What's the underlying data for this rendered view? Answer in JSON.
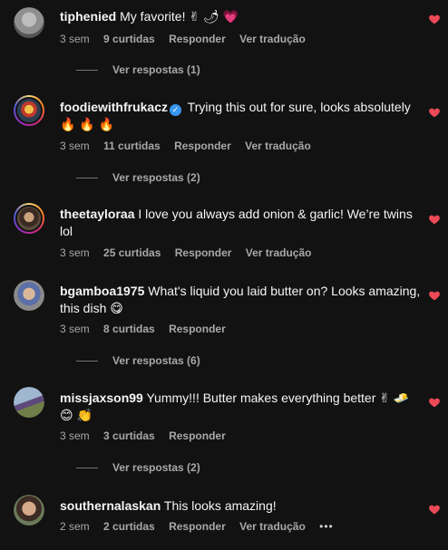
{
  "accent": {
    "heart": "#ed4956",
    "verified": "#3897f0"
  },
  "comments": [
    {
      "username": "tiphenied",
      "verified": false,
      "text": "My favorite! ✌ 🌶 💗",
      "time": "3 sem",
      "likes": "9 curtidas",
      "reply": "Responder",
      "translate": "Ver tradução",
      "view_replies": "Ver respostas (1)"
    },
    {
      "username": "foodiewithfrukacz",
      "verified": true,
      "text": "Trying this out for sure, looks absolutely 🔥 🔥 🔥",
      "time": "3 sem",
      "likes": "11 curtidas",
      "reply": "Responder",
      "translate": "Ver tradução",
      "view_replies": "Ver respostas (2)"
    },
    {
      "username": "theetayloraa",
      "verified": false,
      "text": "I love you always add onion & garlic! We’re twins lol",
      "time": "3 sem",
      "likes": "25 curtidas",
      "reply": "Responder",
      "translate": "Ver tradução",
      "view_replies": ""
    },
    {
      "username": "bgamboa1975",
      "verified": false,
      "text": "What's liquid you laid butter on? Looks amazing, this dish 😋",
      "time": "3 sem",
      "likes": "8 curtidas",
      "reply": "Responder",
      "translate": "",
      "view_replies": "Ver respostas (6)"
    },
    {
      "username": "missjaxson99",
      "verified": false,
      "text": "Yummy!!! Butter makes everything better ✌ 🧈 😊 👏",
      "time": "3 sem",
      "likes": "3 curtidas",
      "reply": "Responder",
      "translate": "",
      "view_replies": "Ver respostas (2)"
    },
    {
      "username": "southernalaskan",
      "verified": false,
      "text": "This looks amazing!",
      "time": "2 sem",
      "likes": "2 curtidas",
      "reply": "Responder",
      "translate": "Ver tradução",
      "more": "•••",
      "view_replies": ""
    }
  ]
}
